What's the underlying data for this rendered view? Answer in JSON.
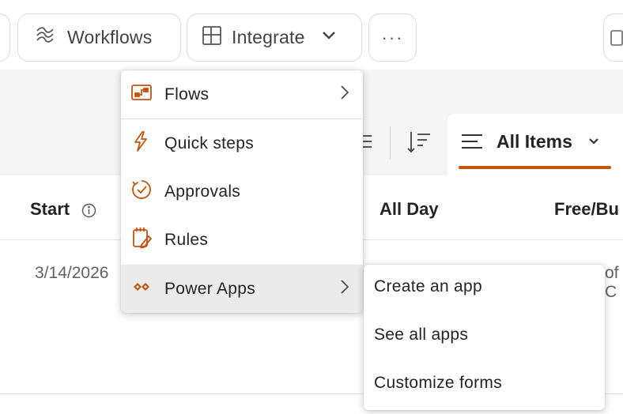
{
  "toolbar": {
    "workflows_label": "Workflows",
    "integrate_label": "Integrate",
    "more_label": "···"
  },
  "view": {
    "label": "All Items"
  },
  "columns": {
    "start": "Start",
    "all_day": "All Day",
    "free_busy": "Free/Bu"
  },
  "rows": [
    {
      "start": "3/14/2026",
      "trailing": "of C"
    }
  ],
  "integrate_menu": {
    "items": [
      {
        "label": "Flows",
        "icon": "flows-icon",
        "has_submenu": true
      },
      {
        "label": "Quick steps",
        "icon": "lightning-icon",
        "has_submenu": false
      },
      {
        "label": "Approvals",
        "icon": "approvals-icon",
        "has_submenu": false
      },
      {
        "label": "Rules",
        "icon": "rules-icon",
        "has_submenu": false
      },
      {
        "label": "Power Apps",
        "icon": "power-apps-icon",
        "has_submenu": true,
        "active": true
      }
    ]
  },
  "power_apps_submenu": {
    "items": [
      {
        "label": "Create an app"
      },
      {
        "label": "See all apps"
      },
      {
        "label": "Customize forms"
      }
    ]
  },
  "colors": {
    "accent": "#c4530f",
    "band": "#f5f5f5",
    "menu_active": "#ebebeb"
  }
}
